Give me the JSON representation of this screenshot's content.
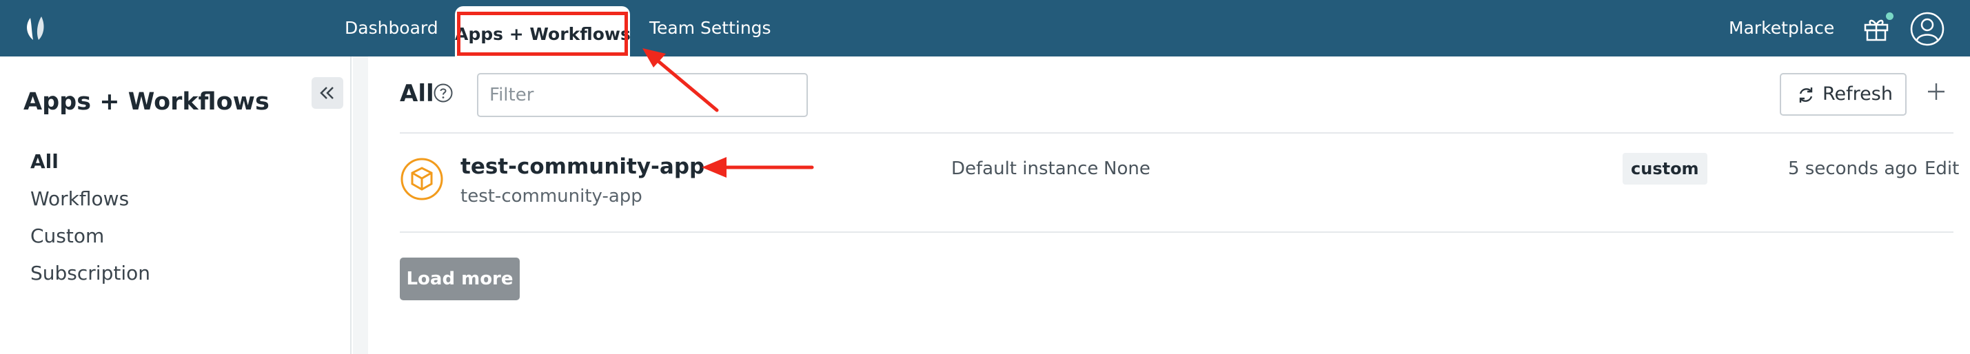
{
  "nav": {
    "items": [
      {
        "label": "Dashboard"
      },
      {
        "label": "Apps + Workflows",
        "active": true
      },
      {
        "label": "Team Settings"
      }
    ],
    "marketplace": "Marketplace",
    "colors": {
      "bar": "#245b7a",
      "annotation": "#f0281c"
    }
  },
  "sidebar": {
    "title": "Apps + Workflows",
    "items": [
      {
        "label": "All",
        "active": true
      },
      {
        "label": "Workflows"
      },
      {
        "label": "Custom"
      },
      {
        "label": "Subscription"
      }
    ]
  },
  "main": {
    "title": "All",
    "filter": {
      "placeholder": "Filter",
      "value": ""
    },
    "refresh_label": "Refresh",
    "rows": [
      {
        "name": "test-community-app",
        "subtitle": "test-community-app",
        "instance_label": "Default instance",
        "instance_value": "None",
        "tag": "custom",
        "updated": "5 seconds ago",
        "action": "Edit"
      }
    ],
    "load_more": "Load more"
  },
  "icons": [
    "logo-icon",
    "gift-icon",
    "user-icon",
    "collapse-icon",
    "help-icon",
    "refresh-icon",
    "add-icon",
    "app-cube-icon"
  ]
}
